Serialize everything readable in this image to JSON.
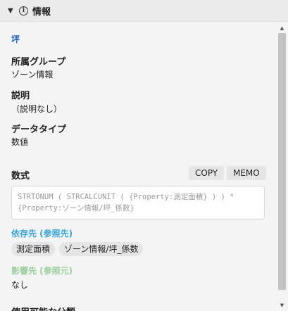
{
  "header": {
    "caret": "▼",
    "info_glyph": "i",
    "title": "情報"
  },
  "property": {
    "name": "坪",
    "group_label": "所属グループ",
    "group_value": "ゾーン情報",
    "description_label": "説明",
    "description_value": "（説明なし）",
    "datatype_label": "データタイプ",
    "datatype_value": "数値",
    "formula_label": "数式",
    "copy_label": "COPY",
    "memo_label": "MEMO",
    "formula_text": "STRTONUM ( STRCALCUNIT ( {Property:測定面積} ) ) *\n{Property:ゾーン情報/坪_係数}"
  },
  "dependencies": {
    "label": "依存先 (参照先)",
    "items": [
      "測定面積",
      "ゾーン情報/坪_係数"
    ]
  },
  "influences": {
    "label": "影響先 (参照元)",
    "value": "なし"
  },
  "partial_next_label": "使用可能な分類",
  "scrollbar": {
    "up": "▲",
    "down": "▼"
  },
  "colors": {
    "name_title": "#1f66c9",
    "dependencies_label": "#3aa5d8",
    "influences_label": "#9bcf9e"
  }
}
